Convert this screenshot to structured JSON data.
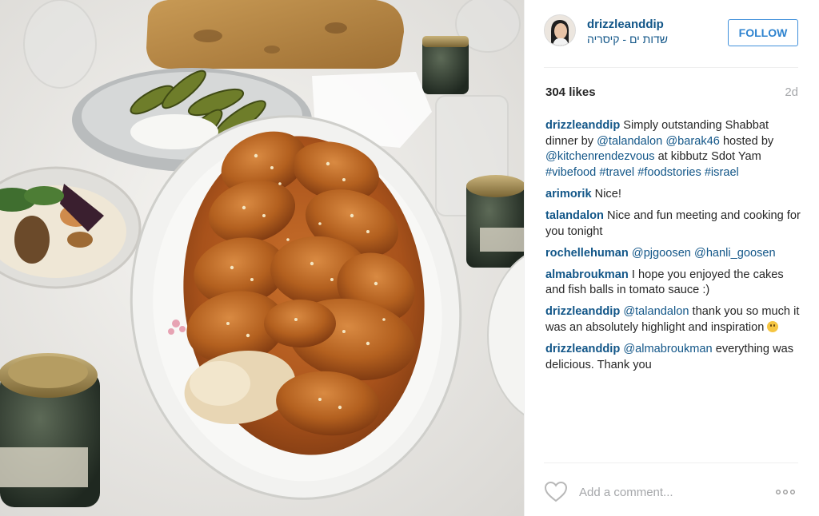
{
  "post": {
    "username": "drizzleanddip",
    "location": "שדות ים - קיסריה",
    "follow_label": "FOLLOW",
    "likes": "304 likes",
    "time": "2d"
  },
  "comments": [
    {
      "user": "drizzleanddip",
      "parts": [
        {
          "text": " Simply outstanding Shabbat dinner by ",
          "link": false
        },
        {
          "text": "@talandalon",
          "link": true
        },
        {
          "text": " ",
          "link": false
        },
        {
          "text": "@barak46",
          "link": true
        },
        {
          "text": " hosted by ",
          "link": false
        },
        {
          "text": "@kitchenrendezvous",
          "link": true
        },
        {
          "text": " at kibbutz Sdot Yam ",
          "link": false
        },
        {
          "text": "#vibefood",
          "link": true
        },
        {
          "text": " ",
          "link": false
        },
        {
          "text": "#travel",
          "link": true
        },
        {
          "text": " ",
          "link": false
        },
        {
          "text": "#foodstories",
          "link": true
        },
        {
          "text": " ",
          "link": false
        },
        {
          "text": "#israel",
          "link": true
        }
      ]
    },
    {
      "user": "arimorik",
      "parts": [
        {
          "text": " Nice!",
          "link": false
        }
      ]
    },
    {
      "user": "talandalon",
      "parts": [
        {
          "text": " Nice and fun meeting and cooking for you tonight",
          "link": false
        }
      ]
    },
    {
      "user": "rochellehuman",
      "parts": [
        {
          "text": " ",
          "link": false
        },
        {
          "text": "@pjgoosen",
          "link": true
        },
        {
          "text": " ",
          "link": false
        },
        {
          "text": "@hanli_goosen",
          "link": true
        }
      ]
    },
    {
      "user": "almabroukman",
      "parts": [
        {
          "text": " I hope you enjoyed the cakes and fish balls in tomato sauce :)",
          "link": false
        }
      ]
    },
    {
      "user": "drizzleanddip",
      "parts": [
        {
          "text": " ",
          "link": false
        },
        {
          "text": "@talandalon",
          "link": true
        },
        {
          "text": " thank you so much it was an absolutely highlight and inspiration ",
          "link": false
        }
      ],
      "emoji": "smiling-face-icon"
    },
    {
      "user": "drizzleanddip",
      "parts": [
        {
          "text": " ",
          "link": false
        },
        {
          "text": "@almabroukman",
          "link": true
        },
        {
          "text": " everything was delicious. Thank you",
          "link": false
        }
      ]
    }
  ],
  "add_comment": {
    "placeholder": "Add a comment...",
    "value": ""
  },
  "icons": {
    "like": "heart-icon",
    "more": "more-options-icon",
    "avatar": "user-avatar"
  },
  "colors": {
    "link": "#125688",
    "follow": "#2e83cf",
    "muted": "#a5a7aa"
  }
}
